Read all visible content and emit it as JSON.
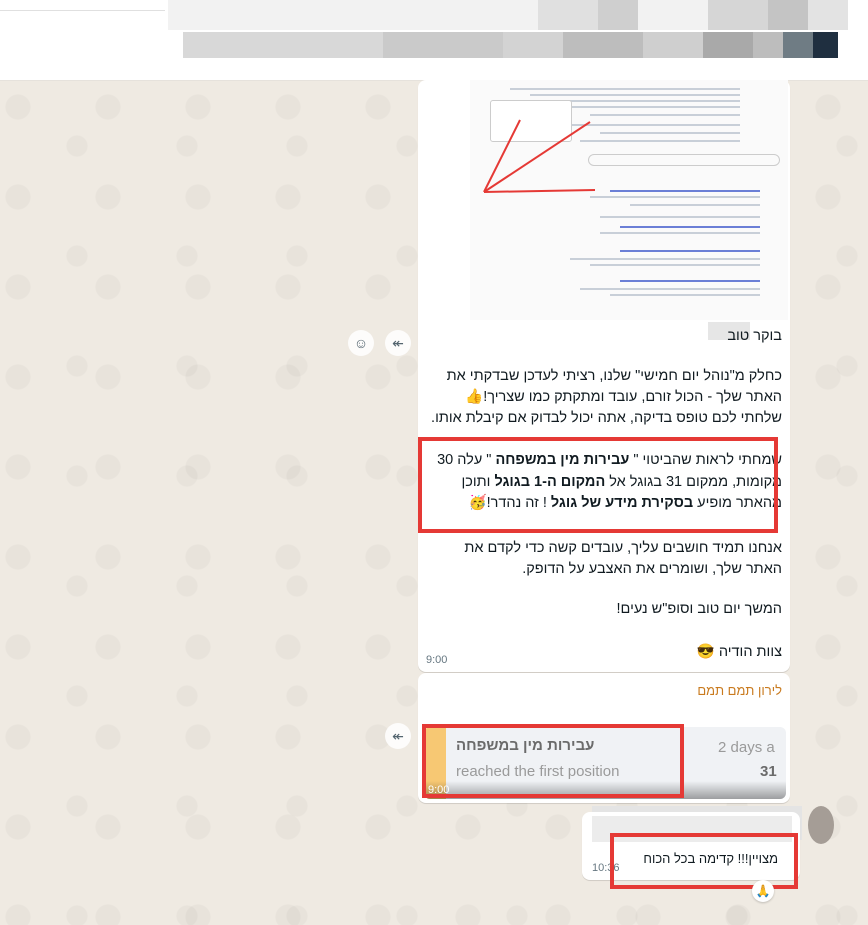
{
  "message1": {
    "greeting": "בוקר טוב",
    "para1_line1": "כחלק מ\"נוהל יום חמישי\" שלנו, רציתי לעדכן שבדקתי את",
    "para1_line2": "האתר שלך - הכול זורם, עובד ומתקתק כמו שצריך!👍",
    "para1_line3": "שלחתי לכם טופס בדיקה, אתה יכול לבדוק אם קיבלת אותו.",
    "para2_line1_pre": "שמחתי לראות שהביטוי \" ",
    "para2_line1_bold": "עבירות מין במשפחה",
    "para2_line1_post": " \" עלה 30",
    "para2_line2_pre": "מקומות, ממקום 31 בגוגל אל ",
    "para2_line2_bold": "המקום ה-1 בגוגל",
    "para2_line2_post": " ותוכן",
    "para2_line3_pre": "מהאתר מופיע ",
    "para2_line3_bold": "בסקירת מידע של גוגל",
    "para2_line3_post": " ! זה נהדר!🥳",
    "para3_line1": "אנחנו תמיד חושבים עליך, עובדים קשה כדי לקדם את",
    "para3_line2": "האתר שלך, ושומרים את האצבע על הדופק.",
    "para4": "המשך יום טוב וסופ\"ש נעים!",
    "signature": "צוות הודיה 😎",
    "time": "9:00"
  },
  "message2": {
    "sender": "לירון תמם תמם",
    "quote_title": "עבירות מין במשפחה",
    "quote_subtitle": "reached the first position",
    "quote_right_top": "2 days a",
    "quote_right_bottom": "31",
    "time": "9:00"
  },
  "message3": {
    "text": "מצויין!!! קדימה בכל הכוח",
    "time": "10:36",
    "reaction": "🙏"
  },
  "colors": {
    "highlight": "#e53935",
    "sender": "#c97a1e",
    "chat_bg": "#efeae2"
  },
  "icons": [
    "smile-icon",
    "forward-icon",
    "forward-icon-2"
  ]
}
